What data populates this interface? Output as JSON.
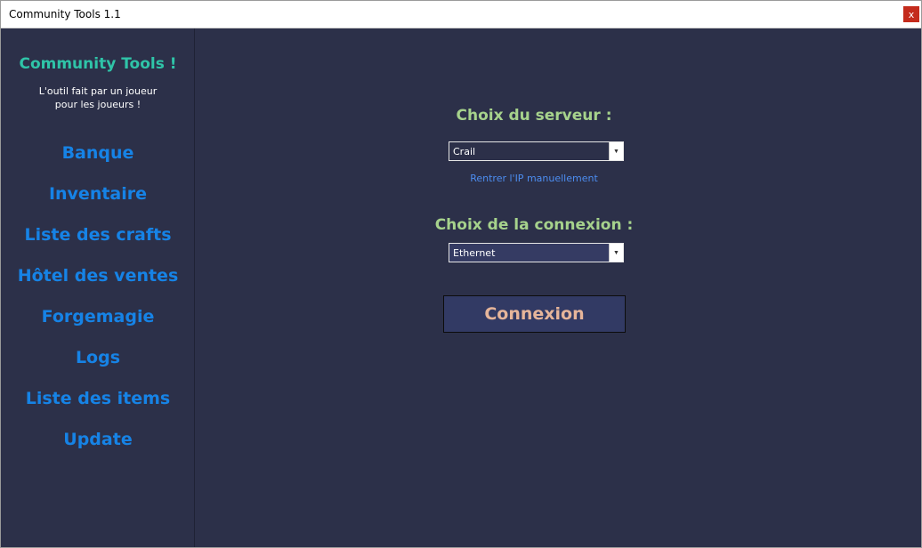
{
  "window": {
    "title": "Community Tools 1.1",
    "close_label": "x"
  },
  "sidebar": {
    "app_title": "Community Tools !",
    "subtitle_line1": "L'outil fait par un joueur",
    "subtitle_line2": "pour les joueurs !",
    "items": [
      {
        "label": "Banque"
      },
      {
        "label": "Inventaire"
      },
      {
        "label": "Liste des crafts"
      },
      {
        "label": "Hôtel des ventes"
      },
      {
        "label": "Forgemagie"
      },
      {
        "label": "Logs"
      },
      {
        "label": "Liste des items"
      },
      {
        "label": "Update"
      }
    ]
  },
  "main": {
    "server_label": "Choix du serveur :",
    "server_value": "Crail",
    "manual_ip_link": "Rentrer l'IP manuellement",
    "connection_label": "Choix de la connexion :",
    "connection_value": "Ethernet",
    "connect_button": "Connexion"
  },
  "colors": {
    "background": "#2c3049",
    "app_title": "#2fc4a8",
    "nav_item": "#1683e6",
    "section_label": "#a6d28c",
    "link": "#4c8df0",
    "button_text": "#e6b59a",
    "button_bg": "#323a64",
    "close_button": "#c42b1c"
  }
}
